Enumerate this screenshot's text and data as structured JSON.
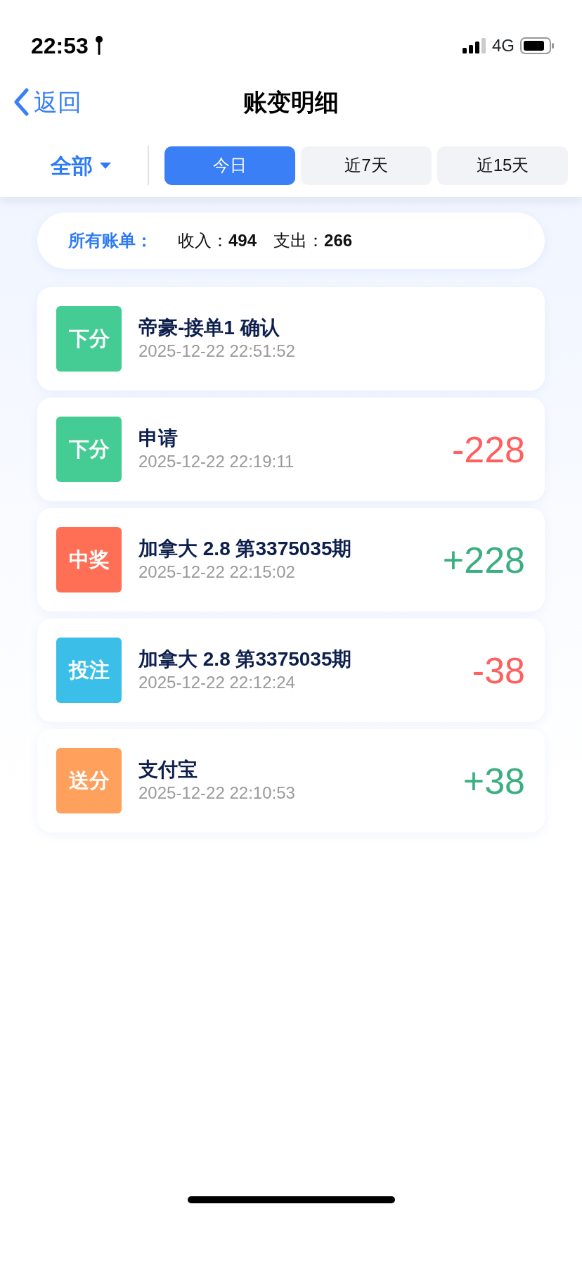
{
  "status_bar": {
    "time": "22:53",
    "network": "4G"
  },
  "header": {
    "back": "返回",
    "title": "账变明细"
  },
  "filter": {
    "category": "全部",
    "periods": [
      {
        "label": "今日",
        "selected": true
      },
      {
        "label": "近7天",
        "selected": false
      },
      {
        "label": "近15天",
        "selected": false
      }
    ]
  },
  "summary": {
    "label": "所有账单：",
    "income_label": "收入：",
    "income": "494",
    "expense_label": "支出：",
    "expense": "266"
  },
  "records": [
    {
      "tag": "下分",
      "color": "#45cc94",
      "title": "帝豪-接单1 确认",
      "time": "2025-12-22 22:51:52"
    },
    {
      "tag": "下分",
      "color": "#45cc94",
      "title": "申请",
      "time": "2025-12-22 22:19:11",
      "amount": "-228",
      "kind": "expense"
    },
    {
      "tag": "中奖",
      "color": "#ff6f55",
      "title": "加拿大 2.8 第3375035期",
      "time": "2025-12-22 22:15:02",
      "amount": "+228",
      "kind": "income"
    },
    {
      "tag": "投注",
      "color": "#3bbfe8",
      "title": "加拿大 2.8 第3375035期",
      "time": "2025-12-22 22:12:24",
      "amount": "-38",
      "kind": "expense"
    },
    {
      "tag": "送分",
      "color": "#ffa05c",
      "title": "支付宝",
      "time": "2025-12-22 22:10:53",
      "amount": "+38",
      "kind": "income"
    }
  ]
}
